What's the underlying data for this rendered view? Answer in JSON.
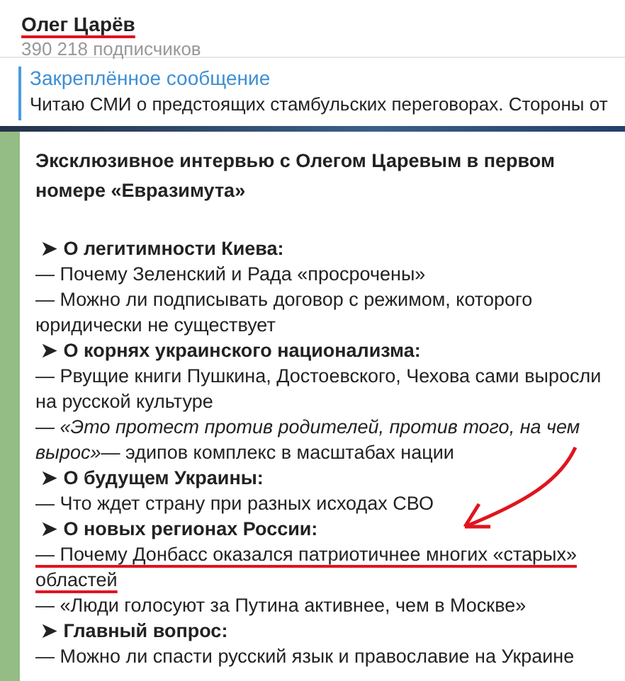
{
  "channel": {
    "name": "Олег Царёв",
    "underlined": true,
    "subscribers": "390 218 подписчиков"
  },
  "pinned": {
    "title": "Закреплённое сообщение",
    "text": "Читаю СМИ о предстоящих стамбульских переговорах. Стороны от"
  },
  "message": {
    "title": "Эксклюзивное интервью с Олегом Царевым в первом номере «Евразимута»",
    "sections": [
      {
        "marker": "➤",
        "heading": "О легитимности Киева:",
        "lines": [
          {
            "text": "— Почему Зеленский и Рада «просрочены»",
            "underlined": false
          },
          {
            "text": "— Можно ли подписывать договор с режимом, которого юридически не существует",
            "underlined": false
          }
        ]
      },
      {
        "marker": "➤",
        "heading": "О корнях украинского национализма:",
        "lines": [
          {
            "text": "—  Рвущие книги Пушкина, Достоевского, Чехова сами выросли на русской культуре",
            "underlined": false
          },
          {
            "text": "— *«Это протест против родителей, против того, на чем вырос»*— эдипов комплекс в масштабах нации",
            "underlined": false
          }
        ]
      },
      {
        "marker": "➤",
        "heading": "О будущем Украины:",
        "lines": [
          {
            "text": "— Что ждет страну при разных исходах СВО",
            "underlined": false
          }
        ]
      },
      {
        "marker": "➤",
        "heading": "О новых регионах России:",
        "lines": [
          {
            "text": "— Почему Донбасс оказался патриотичнее многих «старых» областей",
            "underlined": true
          },
          {
            "text": "— «Люди голосуют за Путина активнее, чем в Москве»",
            "underlined": false
          }
        ]
      },
      {
        "marker": "➤",
        "heading": "Главный вопрос:",
        "lines": [
          {
            "text": "— Можно ли спасти русский язык и православие на Украине",
            "underlined": false
          }
        ]
      }
    ]
  }
}
